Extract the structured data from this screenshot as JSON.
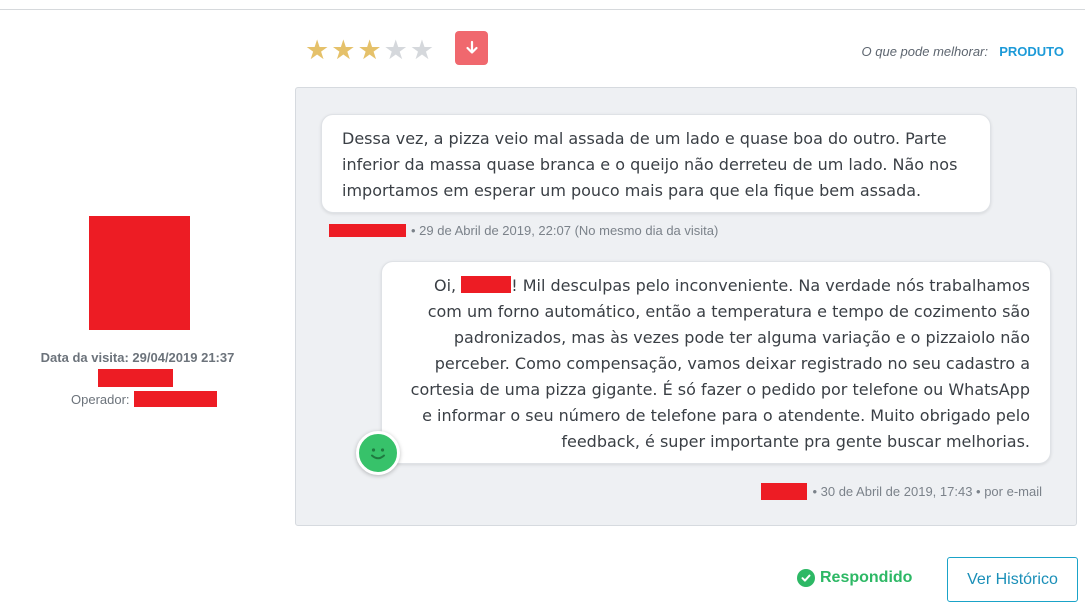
{
  "rating": {
    "stars": [
      {
        "filled": true
      },
      {
        "filled": true
      },
      {
        "filled": true
      },
      {
        "filled": false
      },
      {
        "filled": false
      }
    ],
    "value": 3,
    "max": 5,
    "trend_icon": "arrow-down-icon",
    "trend_color": "#f0686e"
  },
  "improvement": {
    "label": "O que pode melhorar:",
    "value": "PRODUTO"
  },
  "customer": {
    "visit_date": "Data da visita: 29/04/2019 21:37",
    "operator_label": "Operador:"
  },
  "conversation": {
    "customer_message": "Dessa vez, a pizza veio mal assada de um lado e quase boa do outro. Parte inferior da massa quase branca e o queijo não derreteu de um lado. Não nos importamos em esperar um pouco mais para que ela fique bem assada.",
    "customer_meta": "• 29 de Abril de 2019, 22:07 (No mesmo dia da visita)",
    "reply_greeting": "Oi,",
    "reply_message": "! Mil desculpas pelo inconveniente. Na verdade nós trabalhamos com um forno automático, então a temperatura e tempo de cozimento são padronizados, mas às vezes pode ter alguma variação e o pizzaiolo não perceber. Como compensação, vamos deixar registrado no seu cadastro a cortesia de uma pizza gigante. É só fazer o pedido por telefone ou WhatsApp e informar o seu número de telefone para o atendente. Muito obrigado pelo feedback, é super importante pra gente buscar melhorias.",
    "reply_meta": "• 30 de Abril de 2019, 17:43 • por e-mail",
    "sentiment_icon": "smiley-face-icon"
  },
  "footer": {
    "status_label": "Respondido",
    "history_button": "Ver Histórico"
  },
  "colors": {
    "star_on": "#e5c16a",
    "star_off": "#d5d8dc",
    "accent": "#1c9ad8",
    "success": "#2db865",
    "redaction": "#ed1c24"
  }
}
